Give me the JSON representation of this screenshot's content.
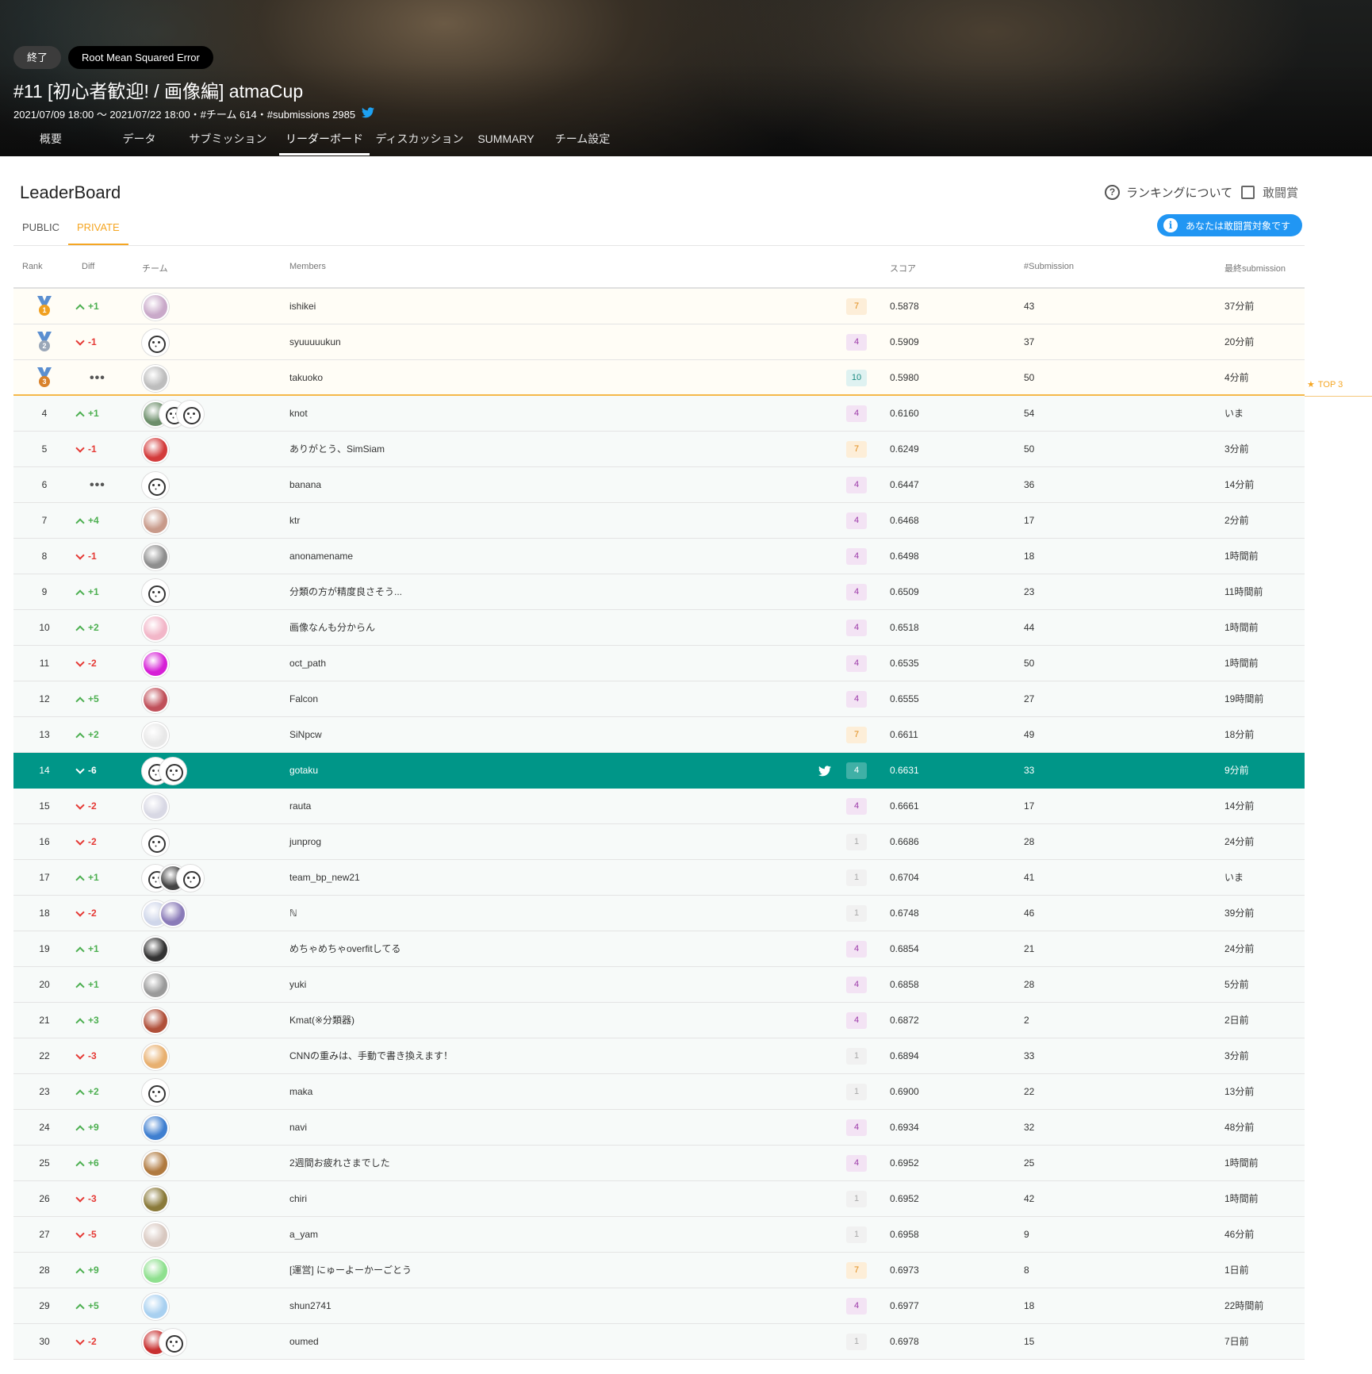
{
  "header": {
    "status_chip": "終了",
    "metric_chip": "Root Mean Squared Error",
    "title": "#11 [初心者歓迎! / 画像編] atmaCup",
    "meta": "2021/07/09 18:00 〜 2021/07/22 18:00・#チーム 614・#submissions 2985",
    "tabs": [
      "概要",
      "データ",
      "サブミッション",
      "リーダーボード",
      "ディスカッション",
      "SUMMARY",
      "チーム設定"
    ],
    "active_tab": "リーダーボード"
  },
  "leaderboard": {
    "title": "LeaderBoard",
    "sub_tabs": [
      "PUBLIC",
      "PRIVATE"
    ],
    "active_sub_tab": "PRIVATE",
    "ranking_help": "ランキングについて",
    "checkbox_label": "敢闘賞",
    "info_pill": "あなたは敢闘賞対象です",
    "top3_label": "TOP 3",
    "columns": {
      "rank": "Rank",
      "diff": "Diff",
      "team": "チーム",
      "members": "Members",
      "score": "スコア",
      "submissions": "#Submission",
      "last": "最終submission"
    }
  },
  "colors": {
    "accent_orange": "#f5a623",
    "highlight_row": "#009688",
    "info_blue": "#2196f3",
    "diff_up": "#4caf50",
    "diff_down": "#e53935",
    "medal_gold": "#f0a020",
    "medal_silver": "#9aa7b8",
    "medal_bronze": "#d9822b"
  },
  "rows": [
    {
      "rank": "1",
      "diff": "+1",
      "dir": "up",
      "name": "ishikei",
      "members": "7",
      "score": "0.5878",
      "subs": "43",
      "last": "37分前",
      "avatars": [
        "#c9a9c9"
      ]
    },
    {
      "rank": "2",
      "diff": "-1",
      "dir": "down",
      "name": "syuuuuukun",
      "members": "4",
      "score": "0.5909",
      "subs": "37",
      "last": "20分前",
      "avatars": [
        "default"
      ]
    },
    {
      "rank": "3",
      "diff": "",
      "dir": "same",
      "name": "takuoko",
      "members": "10",
      "score": "0.5980",
      "subs": "50",
      "last": "4分前",
      "avatars": [
        "#bdbdbd"
      ]
    },
    {
      "rank": "4",
      "diff": "+1",
      "dir": "up",
      "name": "knot",
      "members": "4",
      "score": "0.6160",
      "subs": "54",
      "last": "いま",
      "avatars": [
        "#6c8e6a",
        "default",
        "default"
      ]
    },
    {
      "rank": "5",
      "diff": "-1",
      "dir": "down",
      "name": "ありがとう、SimSiam",
      "members": "7",
      "score": "0.6249",
      "subs": "50",
      "last": "3分前",
      "avatars": [
        "#d33b3b"
      ]
    },
    {
      "rank": "6",
      "diff": "",
      "dir": "same",
      "name": "banana",
      "members": "4",
      "score": "0.6447",
      "subs": "36",
      "last": "14分前",
      "avatars": [
        "default"
      ]
    },
    {
      "rank": "7",
      "diff": "+4",
      "dir": "up",
      "name": "ktr",
      "members": "4",
      "score": "0.6468",
      "subs": "17",
      "last": "2分前",
      "avatars": [
        "#c89a8a"
      ]
    },
    {
      "rank": "8",
      "diff": "-1",
      "dir": "down",
      "name": "anonamename",
      "members": "4",
      "score": "0.6498",
      "subs": "18",
      "last": "1時間前",
      "avatars": [
        "#8e8e8e"
      ]
    },
    {
      "rank": "9",
      "diff": "+1",
      "dir": "up",
      "name": "分類の方が精度良さそう...",
      "members": "4",
      "score": "0.6509",
      "subs": "23",
      "last": "11時間前",
      "avatars": [
        "default"
      ]
    },
    {
      "rank": "10",
      "diff": "+2",
      "dir": "up",
      "name": "画像なんも分からん",
      "members": "4",
      "score": "0.6518",
      "subs": "44",
      "last": "1時間前",
      "avatars": [
        "#f2b6c8"
      ]
    },
    {
      "rank": "11",
      "diff": "-2",
      "dir": "down",
      "name": "oct_path",
      "members": "4",
      "score": "0.6535",
      "subs": "50",
      "last": "1時間前",
      "avatars": [
        "#d61fd6"
      ]
    },
    {
      "rank": "12",
      "diff": "+5",
      "dir": "up",
      "name": "Falcon",
      "members": "4",
      "score": "0.6555",
      "subs": "27",
      "last": "19時間前",
      "avatars": [
        "#c0505a"
      ]
    },
    {
      "rank": "13",
      "diff": "+2",
      "dir": "up",
      "name": "SiNpcw",
      "members": "7",
      "score": "0.6611",
      "subs": "49",
      "last": "18分前",
      "avatars": [
        "#e8e8e8"
      ]
    },
    {
      "rank": "14",
      "diff": "-6",
      "dir": "down",
      "name": "gotaku",
      "members": "4",
      "score": "0.6631",
      "subs": "33",
      "last": "9分前",
      "avatars": [
        "default",
        "default"
      ],
      "me": true
    },
    {
      "rank": "15",
      "diff": "-2",
      "dir": "down",
      "name": "rauta",
      "members": "4",
      "score": "0.6661",
      "subs": "17",
      "last": "14分前",
      "avatars": [
        "#d8d8e4"
      ]
    },
    {
      "rank": "16",
      "diff": "-2",
      "dir": "down",
      "name": "junprog",
      "members": "1",
      "score": "0.6686",
      "subs": "28",
      "last": "24分前",
      "avatars": [
        "default"
      ]
    },
    {
      "rank": "17",
      "diff": "+1",
      "dir": "up",
      "name": "team_bp_new21",
      "members": "1",
      "score": "0.6704",
      "subs": "41",
      "last": "いま",
      "avatars": [
        "default",
        "#444444",
        "default"
      ]
    },
    {
      "rank": "18",
      "diff": "-2",
      "dir": "down",
      "name": "ℕ",
      "members": "1",
      "score": "0.6748",
      "subs": "46",
      "last": "39分前",
      "avatars": [
        "#cfd6ea",
        "#8a7bb8"
      ]
    },
    {
      "rank": "19",
      "diff": "+1",
      "dir": "up",
      "name": "めちゃめちゃoverfitしてる",
      "members": "4",
      "score": "0.6854",
      "subs": "21",
      "last": "24分前",
      "avatars": [
        "#333333"
      ]
    },
    {
      "rank": "20",
      "diff": "+1",
      "dir": "up",
      "name": "yuki",
      "members": "4",
      "score": "0.6858",
      "subs": "28",
      "last": "5分前",
      "avatars": [
        "#9a9a9a"
      ]
    },
    {
      "rank": "21",
      "diff": "+3",
      "dir": "up",
      "name": "Kmat(※分類器)",
      "members": "4",
      "score": "0.6872",
      "subs": "2",
      "last": "2日前",
      "avatars": [
        "#b0503a"
      ]
    },
    {
      "rank": "22",
      "diff": "-3",
      "dir": "down",
      "name": "CNNの重みは、手動で書き換えます！",
      "members": "1",
      "score": "0.6894",
      "subs": "33",
      "last": "3分前",
      "avatars": [
        "#e8b070"
      ]
    },
    {
      "rank": "23",
      "diff": "+2",
      "dir": "up",
      "name": "maka",
      "members": "1",
      "score": "0.6900",
      "subs": "22",
      "last": "13分前",
      "avatars": [
        "default"
      ]
    },
    {
      "rank": "24",
      "diff": "+9",
      "dir": "up",
      "name": "navi",
      "members": "4",
      "score": "0.6934",
      "subs": "32",
      "last": "48分前",
      "avatars": [
        "#3f7fd0"
      ]
    },
    {
      "rank": "25",
      "diff": "+6",
      "dir": "up",
      "name": "2週間お疲れさまでした",
      "members": "4",
      "score": "0.6952",
      "subs": "25",
      "last": "1時間前",
      "avatars": [
        "#b07a40"
      ]
    },
    {
      "rank": "26",
      "diff": "-3",
      "dir": "down",
      "name": "chiri",
      "members": "1",
      "score": "0.6952",
      "subs": "42",
      "last": "1時間前",
      "avatars": [
        "#8a7a3a"
      ]
    },
    {
      "rank": "27",
      "diff": "-5",
      "dir": "down",
      "name": "a_yam",
      "members": "1",
      "score": "0.6958",
      "subs": "9",
      "last": "46分前",
      "avatars": [
        "#d8c8c0"
      ]
    },
    {
      "rank": "28",
      "diff": "+9",
      "dir": "up",
      "name": "[運営] にゅーよーかーごとう",
      "members": "7",
      "score": "0.6973",
      "subs": "8",
      "last": "1日前",
      "avatars": [
        "#8fe08f"
      ]
    },
    {
      "rank": "29",
      "diff": "+5",
      "dir": "up",
      "name": "shun2741",
      "members": "4",
      "score": "0.6977",
      "subs": "18",
      "last": "22時間前",
      "avatars": [
        "#a8d0f0"
      ]
    },
    {
      "rank": "30",
      "diff": "-2",
      "dir": "down",
      "name": "oumed",
      "members": "1",
      "score": "0.6978",
      "subs": "15",
      "last": "7日前",
      "avatars": [
        "#c83030",
        "default"
      ]
    }
  ]
}
